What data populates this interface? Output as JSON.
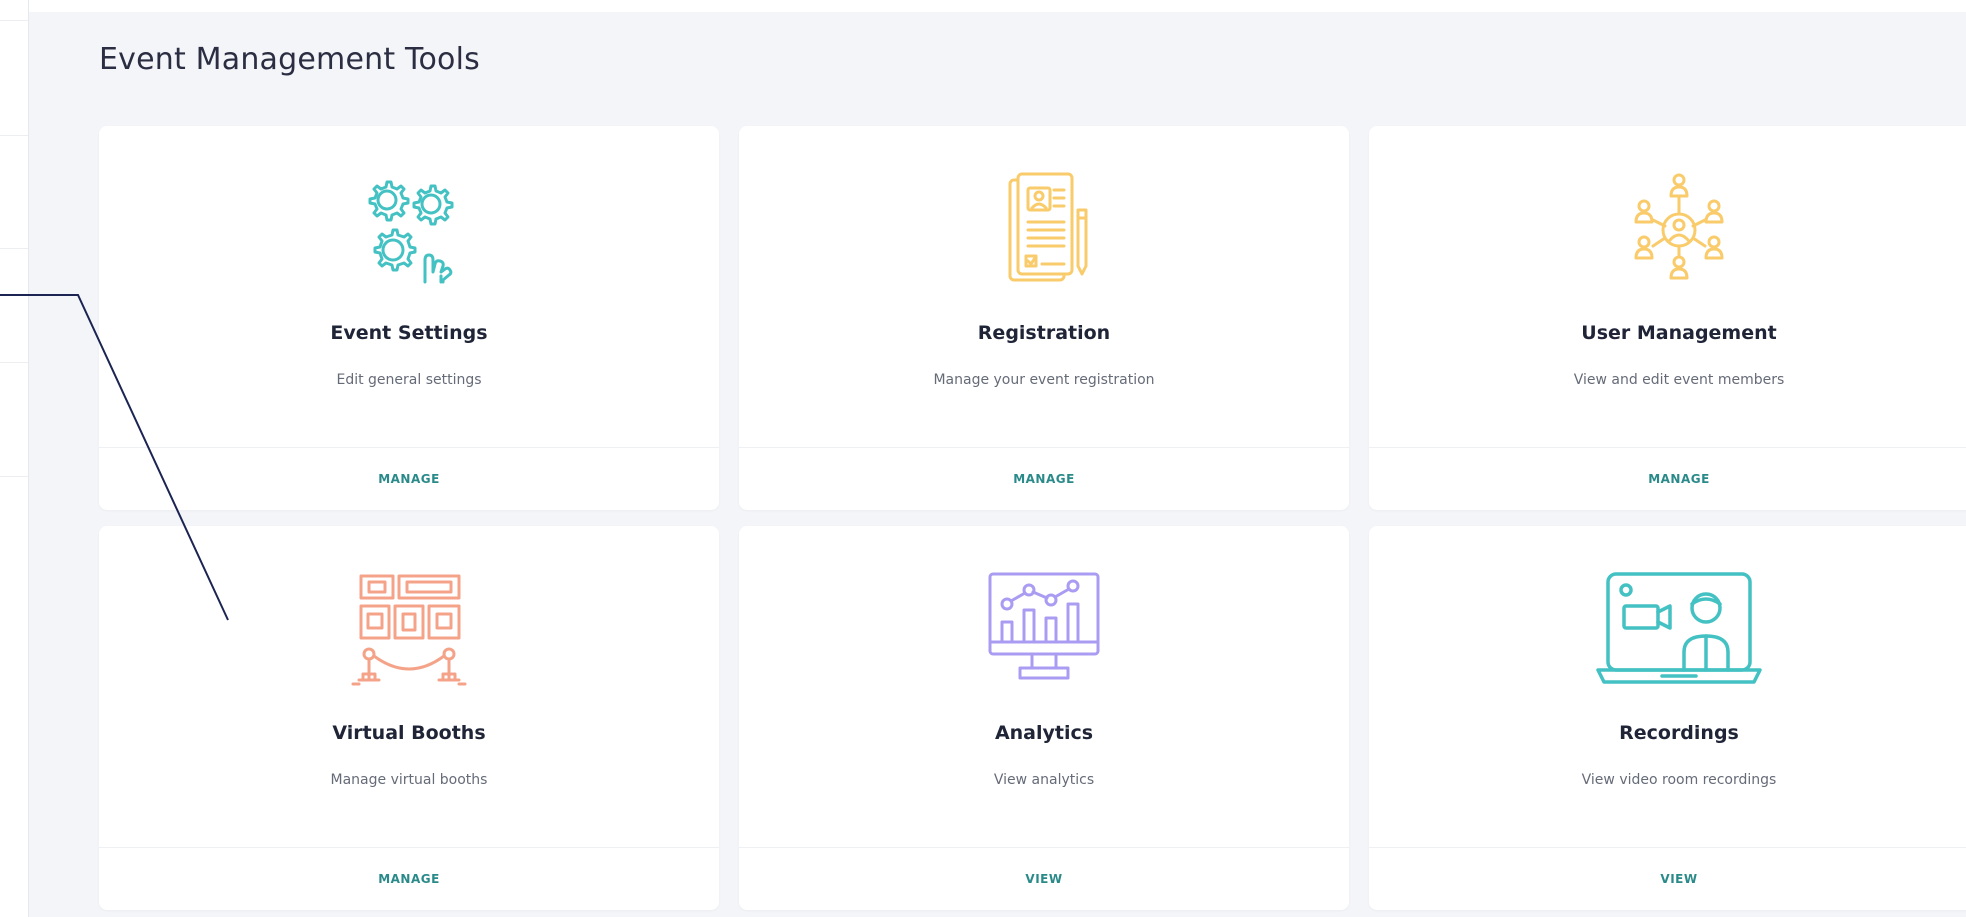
{
  "page": {
    "title": "Event Management Tools"
  },
  "colors": {
    "teal": "#43c1c3",
    "yellow": "#f9cb6b",
    "salmon": "#f4a389",
    "lavender": "#a99cf2",
    "action": "#2a8a8a",
    "annotation_line": "#1b2452"
  },
  "cards": [
    {
      "title": "Event Settings",
      "description": "Edit general settings",
      "action": "MANAGE",
      "icon": "gears-icon"
    },
    {
      "title": "Registration",
      "description": "Manage your event registration",
      "action": "MANAGE",
      "icon": "registration-form-icon"
    },
    {
      "title": "User Management",
      "description": "View and edit event members",
      "action": "MANAGE",
      "icon": "user-network-icon"
    },
    {
      "title": "Virtual Booths",
      "description": "Manage virtual booths",
      "action": "MANAGE",
      "icon": "booths-icon"
    },
    {
      "title": "Analytics",
      "description": "View analytics",
      "action": "VIEW",
      "icon": "analytics-monitor-icon"
    },
    {
      "title": "Recordings",
      "description": "View video room recordings",
      "action": "VIEW",
      "icon": "video-recording-icon"
    }
  ]
}
